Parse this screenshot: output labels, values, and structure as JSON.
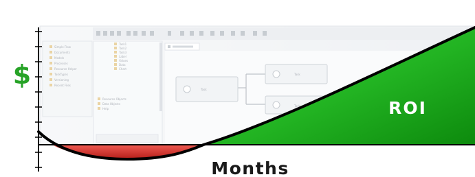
{
  "diagram": {
    "y_axis_label": "$",
    "x_axis_label": "Months",
    "region_label": "ROI",
    "colors": {
      "roi_green": "#2fb82f",
      "roi_green_dark": "#0f8d0f",
      "cost_red": "#d9322a",
      "dollar_green": "#27a327",
      "curve": "#000000",
      "axis": "#000000"
    }
  },
  "background_screenshot": {
    "description": "faded editor window with tree panel and flow diagram",
    "tree_items": [
      "Simple Flow",
      "Documents",
      "Models",
      "Processes",
      "Resource Helper",
      "TaskTypes",
      "Versioning",
      "Recent Files"
    ],
    "subtree_items": [
      "Task1",
      "Task2",
      "Task3",
      "Label",
      "Values",
      "Data",
      "Chart"
    ],
    "lower_items": [
      "Resource Objects",
      "Data Objects",
      "Help"
    ],
    "diagram_nodes": [
      "Task",
      "Task",
      "Task"
    ]
  }
}
